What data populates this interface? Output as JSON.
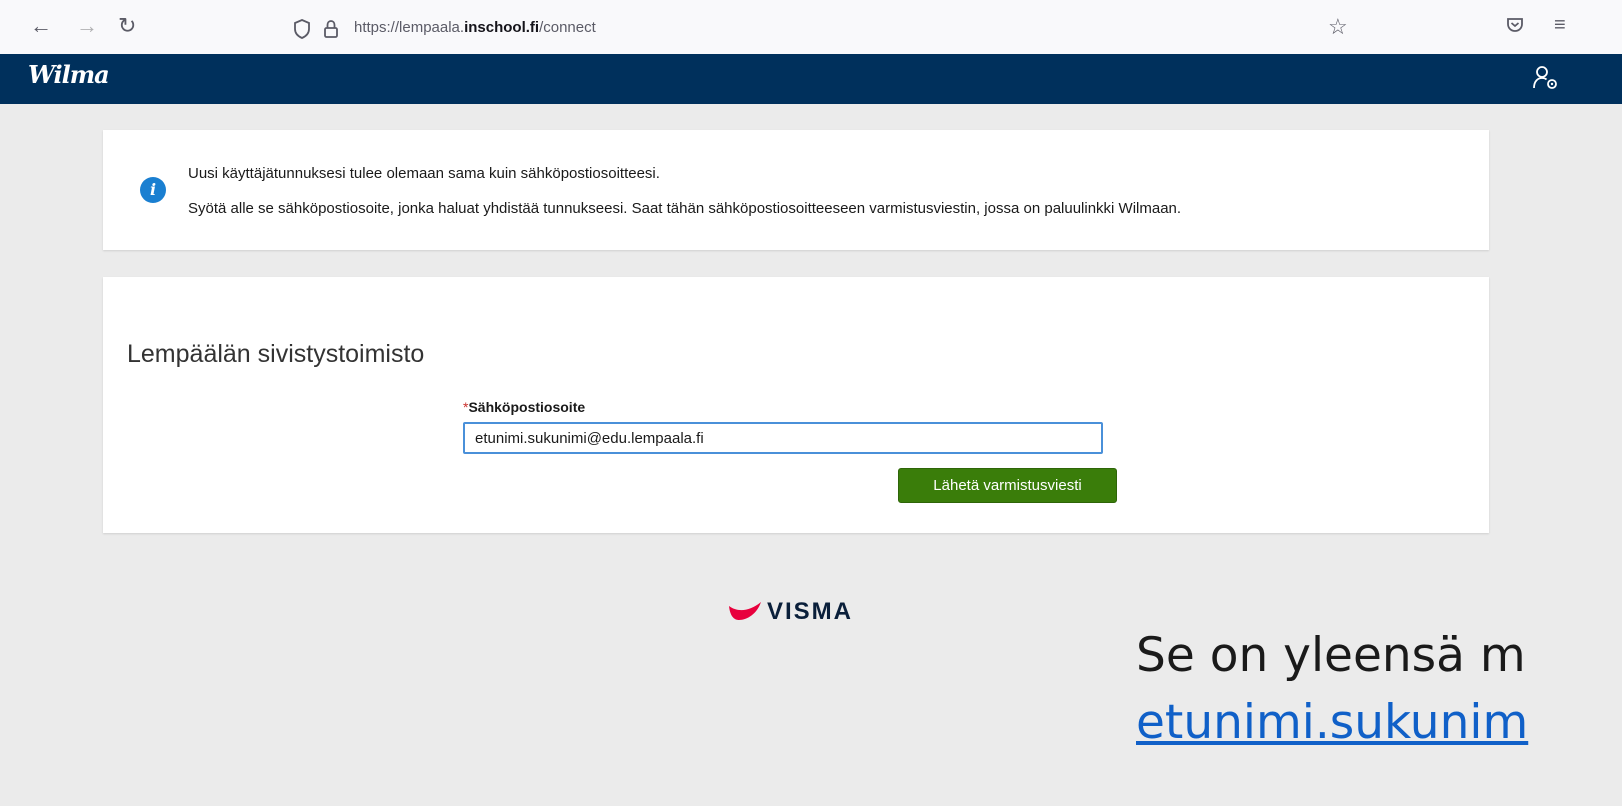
{
  "browser": {
    "url_prefix": "https://lempaala.",
    "url_domain": "inschool.fi",
    "url_path": "/connect"
  },
  "header": {
    "logo": "Wilma"
  },
  "info": {
    "line1": "Uusi käyttäjätunnuksesi tulee olemaan sama kuin sähköpostiosoitteesi.",
    "line2": "Syötä alle se sähköpostiosoite, jonka haluat yhdistää tunnukseesi. Saat tähän sähköpostiosoitteeseen varmistusviestin, jossa on paluulinkki Wilmaan."
  },
  "form": {
    "organization": "Lempäälän sivistystoimisto",
    "required_mark": "*",
    "email_label": "Sähköpostiosoite",
    "email_value": "etunimi.sukunimi@edu.lempaala.fi",
    "submit_label": "Lähetä varmistusviesti"
  },
  "footer": {
    "brand": "VISMA"
  },
  "overlay": {
    "line1": "Se on yleensä m",
    "line2": "etunimi.sukunim"
  },
  "colors": {
    "header_bg": "#00305c",
    "button_green": "#3a7d0a",
    "info_blue": "#1a7fd1",
    "visma_red": "#e8003d"
  }
}
